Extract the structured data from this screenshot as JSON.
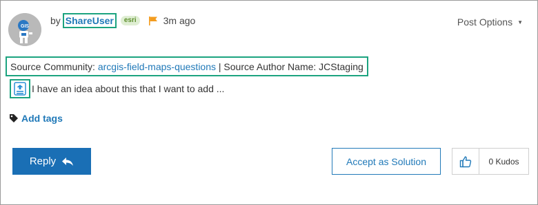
{
  "post": {
    "avatar_icon": "robot-avatar-icon",
    "by_text": "by",
    "username": "ShareUser",
    "badge": "esri",
    "flag_icon": "flag-icon",
    "time": "3m ago",
    "post_options": "Post Options",
    "source_label": "Source Community:",
    "source_community": "arcgis-field-maps-questions",
    "author_label": "| Source Author Name: JCStaging",
    "body_icon": "share-icon",
    "body_text": "I have an idea about this that I want to add ...",
    "add_tags": "Add tags"
  },
  "actions": {
    "reply": "Reply",
    "accept": "Accept as Solution",
    "kudos": "0 Kudos"
  },
  "colors": {
    "link": "#2079b8",
    "highlight": "#1ba37f",
    "reply_bg": "#1a6fb5",
    "badge_bg": "#dfeed3",
    "flag": "#f39c1f"
  }
}
